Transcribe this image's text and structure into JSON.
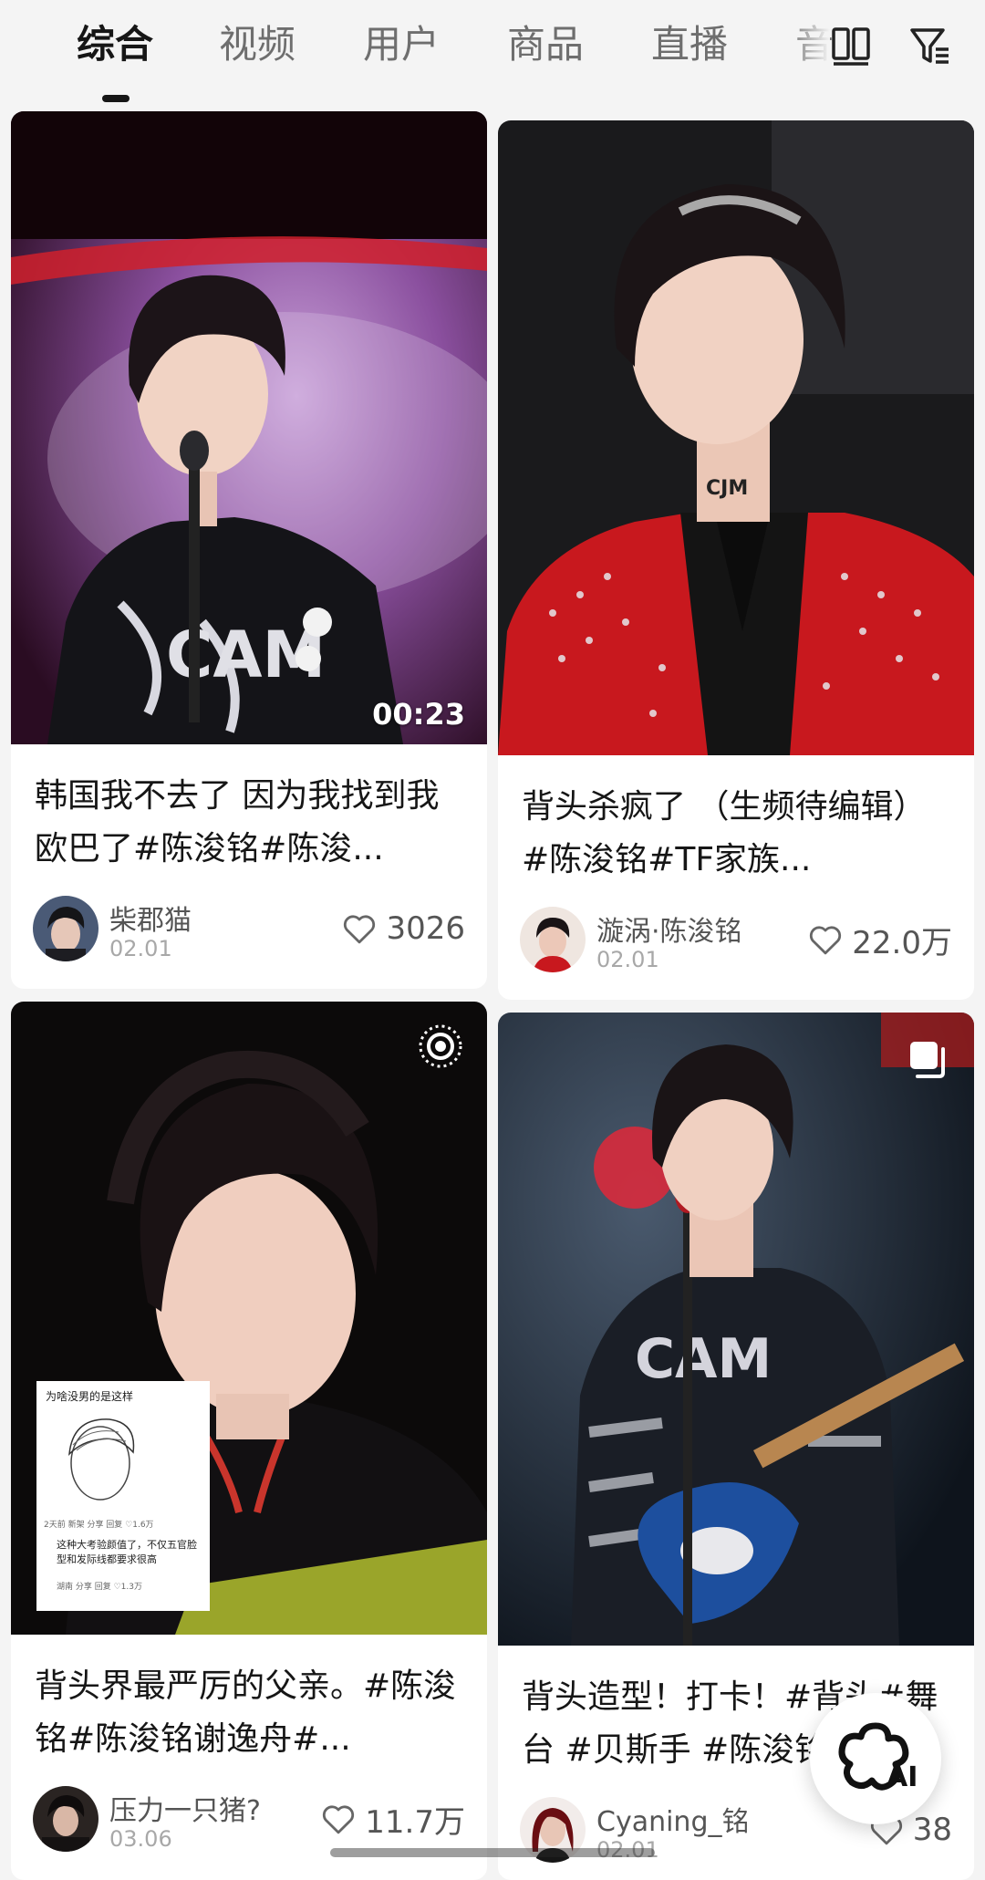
{
  "tabs": [
    {
      "label": "综合",
      "active": true
    },
    {
      "label": "视频",
      "active": false
    },
    {
      "label": "用户",
      "active": false
    },
    {
      "label": "商品",
      "active": false
    },
    {
      "label": "直播",
      "active": false
    },
    {
      "label": "音",
      "active": false
    }
  ],
  "toolbar": {
    "layout_icon": "two-column-layout-icon",
    "filter_icon": "filter-icon"
  },
  "cards": [
    {
      "type": "video",
      "duration": "00:23",
      "caption": "韩国我不去了 因为我找到我欧巴了#陈浚铭#陈浚...",
      "author": "柴郡猫",
      "date": "02.01",
      "likes": "3026"
    },
    {
      "type": "image",
      "caption": "背头杀疯了 （生频待编辑） #陈浚铭#TF家族...",
      "author": "漩涡·陈浚铭",
      "date": "02.01",
      "likes": "22.0万"
    },
    {
      "type": "live-photo",
      "overlay_title": "为啥没男的是这样",
      "overlay_meta1": "2天前  新架  分享  回复  ♡1.6万",
      "overlay_comment": "这种大考验颜值了，不仅五官脸型和发际线都要求很高",
      "overlay_meta2": "湖南  分享  回复  ♡1.3万",
      "caption": "背头界最严厉的父亲。#陈浚铭#陈浚铭谢逸舟#...",
      "author": "压力一只猪?",
      "date": "03.06",
      "likes": "11.7万"
    },
    {
      "type": "multi-image",
      "caption": "背头造型！打卡！#背头#舞台 #贝斯手 #陈浚铭",
      "author": "Cyaning_铭",
      "date": "02.01",
      "likes": "38"
    }
  ],
  "ai_button": {
    "label": "AI"
  },
  "colors": {
    "background": "#f4f4f4",
    "card": "#ffffff",
    "text_primary": "#161616",
    "text_secondary": "#555555",
    "text_tertiary": "#a8a8a8",
    "jacket_red": "#c8181e"
  }
}
